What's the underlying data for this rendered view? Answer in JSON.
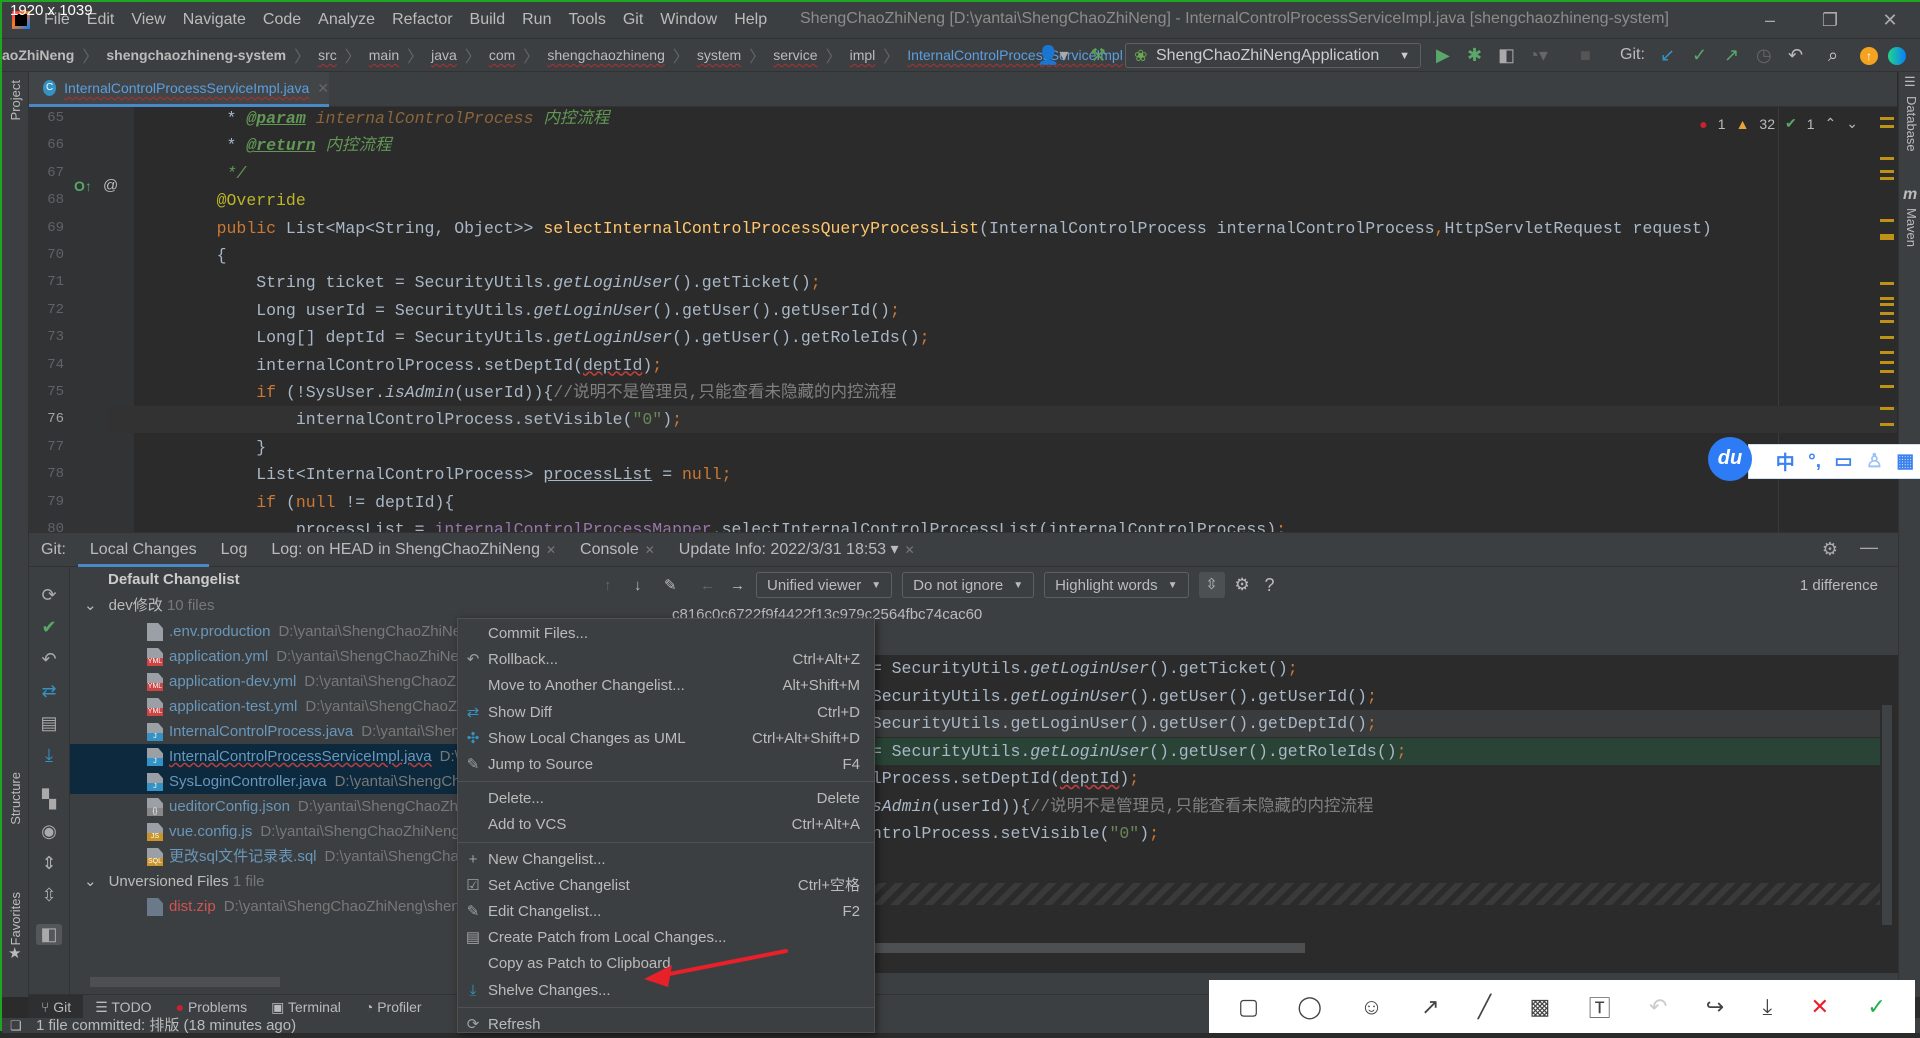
{
  "window": {
    "screen_label": "1920 x 1039",
    "title": "ShengChaoZhiNeng [D:\\yantai\\ShengChaoZhiNeng] - InternalControlProcessServiceImpl.java [shengchaozhineng-system]",
    "menu": [
      "File",
      "Edit",
      "View",
      "Navigate",
      "Code",
      "Analyze",
      "Refactor",
      "Build",
      "Run",
      "Tools",
      "Git",
      "Window",
      "Help"
    ]
  },
  "breadcrumb": [
    "aoZhiNeng",
    "shengchaozhineng-system",
    "src",
    "main",
    "java",
    "com",
    "shengchaozhineng",
    "system",
    "service",
    "impl",
    "InternalControlProcessServiceImpl"
  ],
  "toolbar": {
    "run_config": "ShengChaoZhiNengApplication",
    "git_label": "Git:"
  },
  "editor_tab": {
    "label": "InternalControlProcessServiceImpl.java"
  },
  "side_tools": {
    "project": "Project",
    "structure": "Structure",
    "favorites": "Favorites",
    "database": "Database",
    "maven": "Maven"
  },
  "inspections": {
    "errors": "1",
    "warnings": "32",
    "weak": "1"
  },
  "editor": {
    "current_line": 76,
    "lines": [
      {
        "n": "65",
        "t": [
          [
            "     * ",
            ""
          ],
          [
            "@param",
            "tag"
          ],
          [
            " internalControlProcess",
            "dparam"
          ],
          [
            " 内控流程",
            "doc"
          ]
        ]
      },
      {
        "n": "66",
        "t": [
          [
            "     * ",
            ""
          ],
          [
            "@return",
            "tag"
          ],
          [
            " 内控流程",
            "doc"
          ]
        ]
      },
      {
        "n": "67",
        "t": [
          [
            "     */",
            "doc"
          ]
        ]
      },
      {
        "n": "68",
        "t": [
          [
            "    ",
            ""
          ],
          [
            "@Override",
            "ann"
          ]
        ]
      },
      {
        "n": "69",
        "t": [
          [
            "    ",
            ""
          ],
          [
            "public ",
            "kw"
          ],
          [
            "List<Map<String, Object>> ",
            ""
          ],
          [
            "selectInternalControlProcessQueryProcessList",
            "fn"
          ],
          [
            "(InternalControlProcess internalControlProcess",
            ""
          ],
          [
            ",",
            "kw"
          ],
          [
            "HttpServletRequest request)",
            ""
          ]
        ]
      },
      {
        "n": "70",
        "t": [
          [
            "    {",
            ""
          ]
        ]
      },
      {
        "n": "71",
        "t": [
          [
            "        String ticket = SecurityUtils.",
            ""
          ],
          [
            "getLoginUser",
            "it"
          ],
          [
            "().getTicket()",
            ""
          ],
          [
            ";",
            "kw"
          ]
        ]
      },
      {
        "n": "72",
        "t": [
          [
            "        Long userId = SecurityUtils.",
            ""
          ],
          [
            "getLoginUser",
            "it"
          ],
          [
            "().getUser().getUserId()",
            ""
          ],
          [
            ";",
            "kw"
          ]
        ]
      },
      {
        "n": "73",
        "t": [
          [
            "        Long[] deptId = SecurityUtils.",
            ""
          ],
          [
            "getLoginUser",
            "it"
          ],
          [
            "().getUser().getRoleIds()",
            ""
          ],
          [
            ";",
            "kw"
          ]
        ]
      },
      {
        "n": "74",
        "t": [
          [
            "        internalControlProcess.setDeptId(",
            ""
          ],
          [
            "deptId",
            "wavy"
          ],
          [
            ")",
            ""
          ],
          [
            ";",
            "kw"
          ]
        ]
      },
      {
        "n": "75",
        "t": [
          [
            "        ",
            ""
          ],
          [
            "if ",
            "kw"
          ],
          [
            "(!SysUser.",
            ""
          ],
          [
            "isAdmin",
            "it"
          ],
          [
            "(userId)){",
            ""
          ],
          [
            "//说明不是管理员,只能查看未隐藏的内控流程",
            "cm"
          ]
        ]
      },
      {
        "n": "76",
        "t": [
          [
            "            internalControlProcess.setVisible(",
            ""
          ],
          [
            "\"0\"",
            "str"
          ],
          [
            ")",
            ""
          ],
          [
            ";",
            "kw"
          ]
        ]
      },
      {
        "n": "77",
        "t": [
          [
            "        }",
            ""
          ]
        ]
      },
      {
        "n": "78",
        "t": [
          [
            "        List<InternalControlProcess> ",
            ""
          ],
          [
            "processList",
            "ul"
          ],
          [
            " = ",
            ""
          ],
          [
            "null",
            "kw"
          ],
          [
            ";",
            "kw"
          ]
        ]
      },
      {
        "n": "79",
        "t": [
          [
            "        ",
            ""
          ],
          [
            "if ",
            "kw"
          ],
          [
            "(",
            ""
          ],
          [
            "null ",
            "kw"
          ],
          [
            "!= deptId){",
            ""
          ]
        ]
      },
      {
        "n": "80",
        "t": [
          [
            "            processList = ",
            ""
          ],
          [
            "internalControlProcessMapper",
            "field"
          ],
          [
            ".selectInternalControlProcessList(internalControlProcess)",
            ""
          ],
          [
            ";",
            "kw"
          ]
        ]
      }
    ]
  },
  "ime": {
    "logo": "du",
    "mode": "中",
    "punct": "°,"
  },
  "bottom_panel": {
    "tabs": [
      {
        "label": "Git:",
        "closable": false
      },
      {
        "label": "Local Changes",
        "closable": false,
        "selected": true
      },
      {
        "label": "Log",
        "closable": false
      },
      {
        "label": "Log: on HEAD in ShengChaoZhiNeng",
        "closable": true
      },
      {
        "label": "Console",
        "closable": true
      },
      {
        "label": "Update Info: 2022/3/31 18:53",
        "closable": true,
        "dropdown": true
      }
    ],
    "tree": {
      "default_changelist": "Default Changelist",
      "changelist": {
        "name": "dev修改",
        "count": "10 files"
      },
      "files": [
        {
          "name": ".env.production",
          "path": "D:\\yantai\\ShengChaoZhiNeng",
          "type": "txt",
          "badge": ""
        },
        {
          "name": "application.yml",
          "path": "D:\\yantai\\ShengChaoZhiNeng",
          "type": "yml",
          "badge": "YML"
        },
        {
          "name": "application-dev.yml",
          "path": "D:\\yantai\\ShengChaoZhiNeng",
          "type": "yml",
          "badge": "YML"
        },
        {
          "name": "application-test.yml",
          "path": "D:\\yantai\\ShengChaoZhiNeng",
          "type": "yml",
          "badge": "YML"
        },
        {
          "name": "InternalControlProcess.java",
          "path": "D:\\yantai\\ShengChaoZhiNeng",
          "type": "java",
          "badge": "J"
        },
        {
          "name": "InternalControlProcessServiceImpl.java",
          "path": "D:\\yantai\\ShengChaoZhiNeng",
          "type": "java",
          "badge": "J",
          "selected": true
        },
        {
          "name": "SysLoginController.java",
          "path": "D:\\yantai\\ShengChaoZhiNeng",
          "type": "java",
          "badge": "J",
          "selected": true
        },
        {
          "name": "ueditorConfig.json",
          "path": "D:\\yantai\\ShengChaoZhiNeng",
          "type": "json",
          "badge": "{}"
        },
        {
          "name": "vue.config.js",
          "path": "D:\\yantai\\ShengChaoZhiNeng",
          "type": "js",
          "badge": "JS"
        },
        {
          "name": "更改sql文件记录表.sql",
          "path": "D:\\yantai\\ShengChaoZhiNeng",
          "type": "sql",
          "badge": "SQL"
        }
      ],
      "unversioned": {
        "name": "Unversioned Files",
        "count": "1 file"
      },
      "unversioned_files": [
        {
          "name": "dist.zip",
          "path": "D:\\yantai\\ShengChaoZhiNeng\\shen"
        }
      ]
    },
    "diff": {
      "viewer": "Unified viewer",
      "ignore": "Do not ignore",
      "highlight": "Highlight words",
      "help": "?",
      "differences": "1 difference",
      "revision": "c816c0c6722f9f4422f13c979c2564fbc74cac60",
      "lines": [
        {
          "k": "",
          "t": [
            [
              "        String ticket = SecurityUtils.",
              ""
            ],
            [
              "getLoginUser",
              "it"
            ],
            [
              "().getTicket()",
              ""
            ],
            [
              ";",
              "kw"
            ]
          ]
        },
        {
          "k": "",
          "t": [
            [
              "        Long userId = SecurityUtils.",
              ""
            ],
            [
              "getLoginUser",
              "it"
            ],
            [
              "().getUser().getUserId()",
              ""
            ],
            [
              ";",
              "kw"
            ]
          ]
        },
        {
          "k": "del",
          "t": [
            [
              "        Long deptId = SecurityUtils.getLoginUser().getUser().getDeptId()",
              ""
            ],
            [
              ";",
              "kw"
            ]
          ]
        },
        {
          "k": "add",
          "t": [
            [
              "        Long[] deptId = SecurityUtils.",
              ""
            ],
            [
              "getLoginUser",
              "it"
            ],
            [
              "().getUser().getRoleIds()",
              ""
            ],
            [
              ";",
              "kw"
            ]
          ]
        },
        {
          "k": "",
          "t": [
            [
              "        internalControlProcess.setDeptId(",
              ""
            ],
            [
              "deptId",
              "wavy"
            ],
            [
              ")",
              ""
            ],
            [
              ";",
              "kw"
            ]
          ]
        },
        {
          "k": "",
          "t": [
            [
              "        ",
              ""
            ],
            [
              "if ",
              "kw"
            ],
            [
              "(!SysUser.",
              ""
            ],
            [
              "isAdmin",
              "it"
            ],
            [
              "(userId)){",
              ""
            ],
            [
              "//说明不是管理员,只能查看未隐藏的内控流程",
              "cm"
            ]
          ]
        },
        {
          "k": "",
          "t": [
            [
              "            internalControlProcess.setVisible(",
              ""
            ],
            [
              "\"0\"",
              "str"
            ],
            [
              ")",
              ""
            ],
            [
              ";",
              "kw"
            ]
          ]
        }
      ]
    }
  },
  "context_menu": [
    {
      "label": "Commit Files...",
      "shortcut": "",
      "icon": ""
    },
    {
      "label": "Rollback...",
      "shortcut": "Ctrl+Alt+Z",
      "icon": "rollback-icon"
    },
    {
      "label": "Move to Another Changelist...",
      "shortcut": "Alt+Shift+M",
      "icon": ""
    },
    {
      "label": "Show Diff",
      "shortcut": "Ctrl+D",
      "icon": "diff-icon"
    },
    {
      "label": "Show Local Changes as UML",
      "shortcut": "Ctrl+Alt+Shift+D",
      "icon": "uml-icon"
    },
    {
      "label": "Jump to Source",
      "shortcut": "F4",
      "icon": "pencil-icon",
      "sep_after": true
    },
    {
      "label": "Delete...",
      "shortcut": "Delete",
      "icon": ""
    },
    {
      "label": "Add to VCS",
      "shortcut": "Ctrl+Alt+A",
      "icon": "",
      "sep_after": true
    },
    {
      "label": "New Changelist...",
      "shortcut": "",
      "icon": "plus-icon"
    },
    {
      "label": "Set Active Changelist",
      "shortcut": "Ctrl+空格",
      "icon": "checkbox-icon"
    },
    {
      "label": "Edit Changelist...",
      "shortcut": "F2",
      "icon": "pencil-icon"
    },
    {
      "label": "Create Patch from Local Changes...",
      "shortcut": "",
      "icon": "patch-icon"
    },
    {
      "label": "Copy as Patch to Clipboard",
      "shortcut": "",
      "icon": ""
    },
    {
      "label": "Shelve Changes...",
      "shortcut": "",
      "icon": "shelve-icon",
      "highlighted_by_arrow": true,
      "sep_after": true
    },
    {
      "label": "Refresh",
      "shortcut": "",
      "icon": "refresh-icon"
    }
  ],
  "tool_windows": [
    "Git",
    "TODO",
    "Problems",
    "Terminal",
    "Profiler"
  ],
  "status": {
    "message": "1 file committed: 排版 (18 minutes ago)"
  },
  "annotation_arrow_color": "#e8202a",
  "colors": {
    "accent": "#4a88c7",
    "file_modified": "#6897bb",
    "unversioned": "#d25252"
  }
}
